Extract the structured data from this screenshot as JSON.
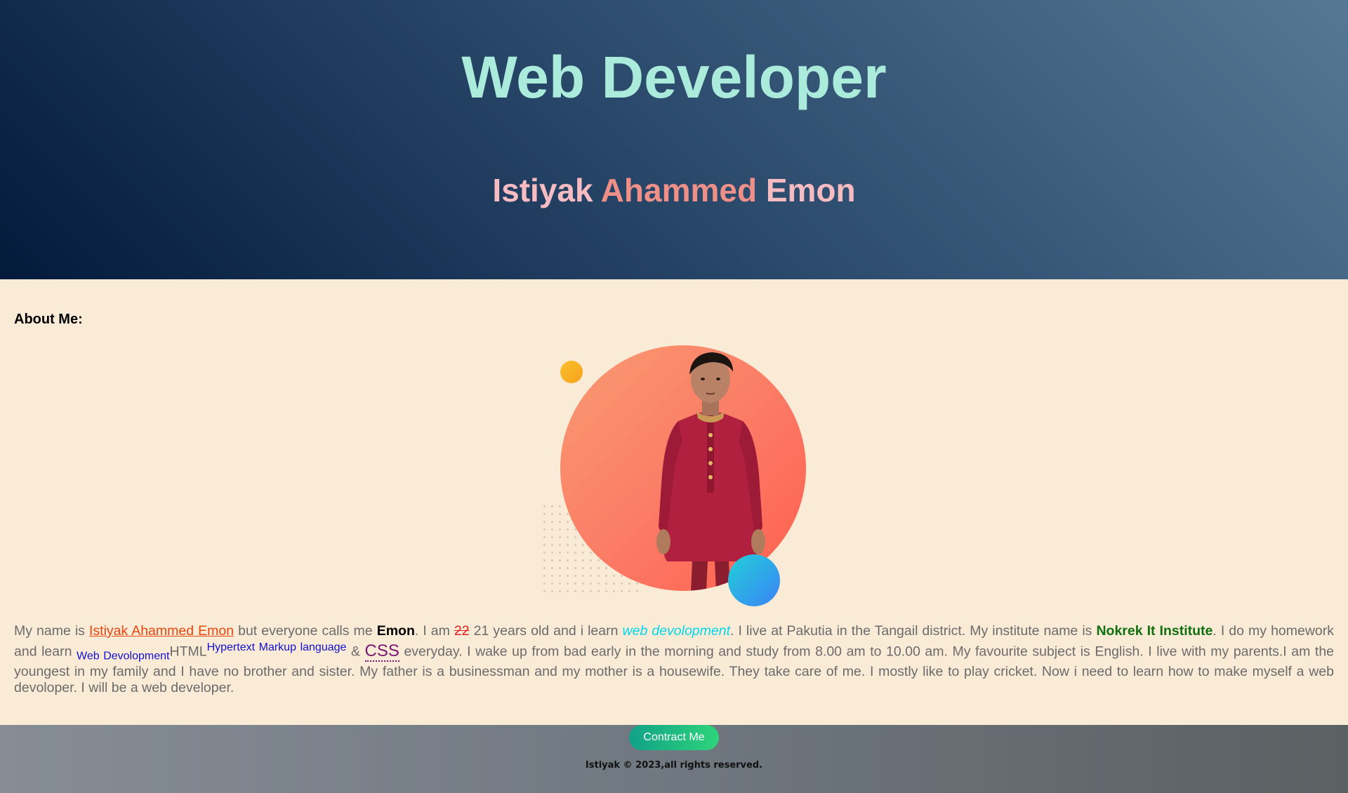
{
  "header": {
    "title": "Web Developer",
    "name_first": "Istiyak",
    "name_middle": "Ahammed",
    "name_last": "Emon"
  },
  "about": {
    "heading": "About Me:",
    "bio": {
      "t1": "My name is ",
      "link_name": "Istiyak Ahammed Emon",
      "t2": " but everyone calls me ",
      "nickname": "Emon",
      "t3": ". I am ",
      "old_age": "22",
      "t4": " 21 years old and i learn ",
      "web_dev": "web devolopment",
      "t5": ". I live at Pakutia in the Tangail district. My institute name is ",
      "institute": "Nokrek It Institute",
      "t6": ". I do my homework and learn ",
      "sub_text": "Web Devolopment",
      "html": "HTML",
      "sup_text": "Hypertext Markup language",
      "t7": " & ",
      "css": "CSS",
      "t8": " everyday. I wake up from bad early in the morning and study from 8.00 am to 10.00 am. My favourite subject is English. I live with my parents.I am the youngest in my family and I have no brother and sister. My father is a businessman and my mother is a housewife. They take care of me. I mostly like to play cricket. Now i need to learn how to make myself a web devoloper. I will be a web developer."
    }
  },
  "footer": {
    "contact_label": "Contract Me",
    "copyright": "Istiyak © 2023,all rights reserved."
  },
  "colors": {
    "title": "#abebdc",
    "name_accent": "#ee8f88",
    "page_bg": "#faebd7",
    "link": "#e8460f",
    "institute": "#107010",
    "button": "#2ed47a"
  }
}
